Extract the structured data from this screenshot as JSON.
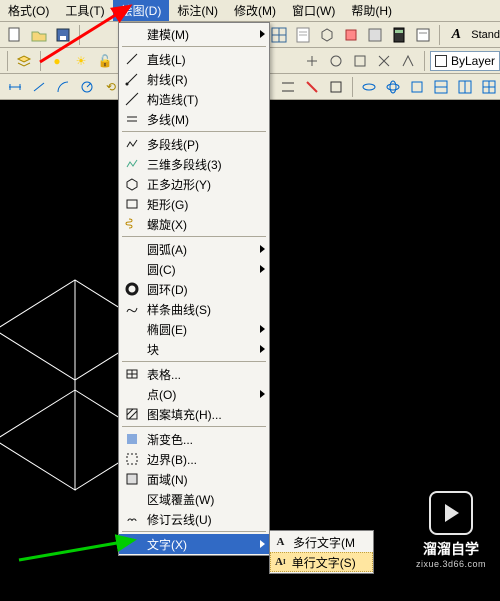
{
  "menubar": {
    "format": "格式(O)",
    "tools": "工具(T)",
    "draw": "绘图(D)",
    "dim": "标注(N)",
    "modify": "修改(M)",
    "window": "窗口(W)",
    "help": "帮助(H)"
  },
  "toolbar": {
    "stand": "Stand",
    "bylayer": "ByLayer"
  },
  "menu": {
    "modeling": "建模(M)",
    "line": "直线(L)",
    "ray": "射线(R)",
    "xline": "构造线(T)",
    "mline": "多线(M)",
    "pline": "多段线(P)",
    "pline3d": "三维多段线(3)",
    "polygon": "正多边形(Y)",
    "rect": "矩形(G)",
    "helix": "螺旋(X)",
    "arc": "圆弧(A)",
    "circle": "圆(C)",
    "donut": "圆环(D)",
    "spline": "样条曲线(S)",
    "ellipse": "椭圆(E)",
    "block": "块",
    "table": "表格...",
    "point": "点(O)",
    "hatch": "图案填充(H)...",
    "gradient": "渐变色...",
    "boundary": "边界(B)...",
    "region": "面域(N)",
    "wipeout": "区域覆盖(W)",
    "revcloud": "修订云线(U)",
    "text": "文字(X)"
  },
  "submenu": {
    "mtext": "多行文字(M",
    "dtext": "单行文字(S)"
  },
  "watermark": {
    "name": "溜溜自学",
    "url": "zixue.3d66.com"
  }
}
